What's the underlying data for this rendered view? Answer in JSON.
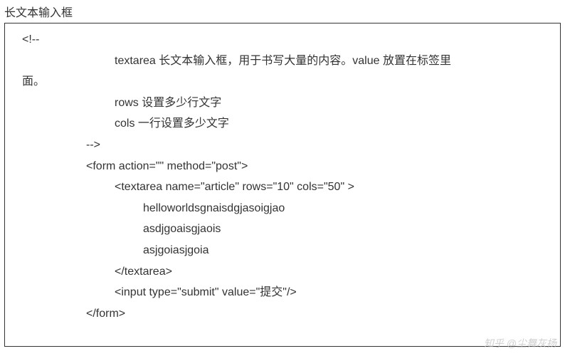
{
  "title": "长文本输入框",
  "code": {
    "comment_open": "<!--",
    "comment_line1_a": "textarea 长文本输入框，用于书写大量的内容。value 放置在标签里",
    "comment_line1_b": "面。",
    "comment_line2": "rows 设置多少行文字",
    "comment_line3": "cols 一行设置多少文字",
    "comment_close": "-->",
    "form_open": "<form action=\"\" method=\"post\">",
    "textarea_open": "<textarea name=\"article\" rows=\"10\" cols=\"50\" >",
    "content1": "helloworldsgnaisdgjasoigjao",
    "content2": "asdjgoaisgjaois",
    "content3": "asjgoiasjgoia",
    "textarea_close": "</textarea>",
    "input_submit": "<input type=\"submit\" value=\"提交\"/>",
    "form_close": "</form>"
  },
  "watermark": "知乎 @尘舞灰扬"
}
